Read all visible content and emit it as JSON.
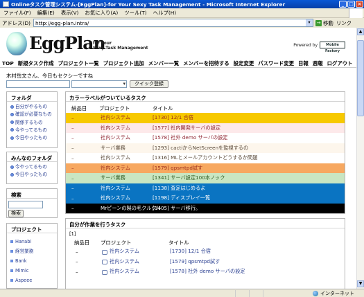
{
  "window": {
    "title": "Onlineタスク管理システム-[EggPlan]-for Your Sexy Task Management - Microsoft Internet Explorer"
  },
  "menu": [
    "ファイル(F)",
    "編集(E)",
    "表示(V)",
    "お気に入り(A)",
    "ツール(T)",
    "ヘルプ(H)"
  ],
  "address": {
    "label": "アドレス(D)",
    "url": "http://egg-plan.intra/",
    "go_label": "移動",
    "links_label": "リンク"
  },
  "header": {
    "brand": "EggPlan",
    "tagline_1": "for Your",
    "tagline_2": "Sexy Task Management",
    "powered_by": "Powered by",
    "company": "Mobile Factory"
  },
  "nav": [
    "TOP",
    "新規タスク作成",
    "プロジェクト一覧",
    "プロジェクト追加",
    "メンバー一覧",
    "メンバーを招待する",
    "設定変更",
    "パスワード変更",
    "日報",
    "週報",
    "ログアウト"
  ],
  "greeting": "木村岳文さん、今日もセクシーですね",
  "quick": {
    "button": "クイック登録"
  },
  "sidebar": {
    "folders": {
      "title": "フォルダ",
      "items": [
        "自分がやるもの",
        "確認が必要なもの",
        "関係するもの",
        "今やってるもの",
        "今日やったもの"
      ]
    },
    "shared": {
      "title": "みんなのフォルダ",
      "items": [
        "今やってるもの",
        "今日やったもの"
      ]
    },
    "search": {
      "title": "検索",
      "button": "検索"
    },
    "projects": {
      "title": "プロジェクト",
      "items": [
        "Hanabi",
        "経営業務",
        "Bank",
        "Mimic",
        "Aspeee"
      ]
    }
  },
  "colored_tasks": {
    "title": "カラーラベルがついているタスク",
    "headers": {
      "due": "納品日",
      "project": "プロジェクト",
      "title": "タイトル"
    },
    "rows": [
      {
        "due": "–",
        "project": "社内システム",
        "title": "[1730] 12/1 合宿",
        "bg": "#f7c900",
        "fg": "#9b2d1c"
      },
      {
        "due": "–",
        "project": "社内システム",
        "title": "[1577] 社内開発サーバの設定",
        "bg": "#fde9ea",
        "fg": "#8f2430"
      },
      {
        "due": "–",
        "project": "社内システム",
        "title": "[1578] 社外 demo サーバの設定",
        "bg": "#ffffff",
        "fg": "#8f2430"
      },
      {
        "due": "–",
        "project": "サーバ業務",
        "title": "[1293]  cactiからNetScreenを監視するの",
        "bg": "#fdf6ec",
        "fg": "#5a4a3a"
      },
      {
        "due": "–",
        "project": "社内システム",
        "title": "[1316] MLとメールアカウントどうするか問題",
        "bg": "#ffffff",
        "fg": "#5a4a3a"
      },
      {
        "due": "–",
        "project": "社内システム",
        "title": "[1579] qpsmtpd試す",
        "bg": "#f7a860",
        "fg": "#9b2d1c"
      },
      {
        "due": "–",
        "project": "サーバ業務",
        "title": "[1341] サーバ設定100本ノック",
        "bg": "#c9e6c2",
        "fg": "#2d5a22"
      },
      {
        "due": "–",
        "project": "社内システム",
        "title": "[1138] 査定はじめるよ",
        "bg": "#0a74c2",
        "fg": "#ffffff"
      },
      {
        "due": "–",
        "project": "社内システム",
        "title": "[1198] ディスプレイ一覧",
        "bg": "#0a74c2",
        "fg": "#ffffff"
      },
      {
        "due": "–",
        "project": "Mrピーンの製の毛クルクル",
        "title": "[1405] サーバ移行。",
        "bg": "#000000",
        "fg": "#ffffff"
      }
    ]
  },
  "my_tasks": {
    "title": "自分が作業を行うタスク",
    "count": "[1]",
    "headers": {
      "due": "納品日",
      "project": "プロジェクト",
      "title": "タイトル"
    },
    "rows": [
      {
        "due": "–",
        "project": "社内システム",
        "title": "[1730] 12/1 合宿"
      },
      {
        "due": "–",
        "project": "社内システム",
        "title": "[1579] qpsmtpd試す"
      },
      {
        "due": "–",
        "project": "社内システム",
        "title": "[1578] 社外 demo サーバの設定"
      }
    ]
  },
  "status": {
    "zone": "インターネット"
  }
}
